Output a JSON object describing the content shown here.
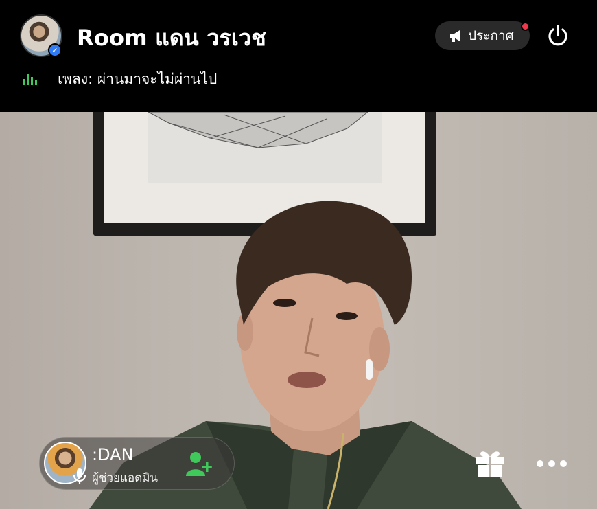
{
  "header": {
    "room_title": "Room แดน วรเวช",
    "announce_label": "ประกาศ",
    "song_label": "เพลง: ผ่านมาจะไม่ผ่านไป"
  },
  "host": {
    "name": ":DAN",
    "role": "ผู้ช่วยแอดมิน"
  },
  "icons": {
    "verified": "verified-check",
    "announce": "megaphone-icon",
    "power": "power-icon",
    "music": "equalizer-bars-icon",
    "mic": "microphone-icon",
    "add_friend": "add-user-icon",
    "gift": "gift-icon",
    "more": "more-dots-icon"
  },
  "colors": {
    "header_bg": "#000000",
    "accent_green": "#3ec95a",
    "notify_red": "#f0384c",
    "verified_blue": "#2f7cf6"
  }
}
